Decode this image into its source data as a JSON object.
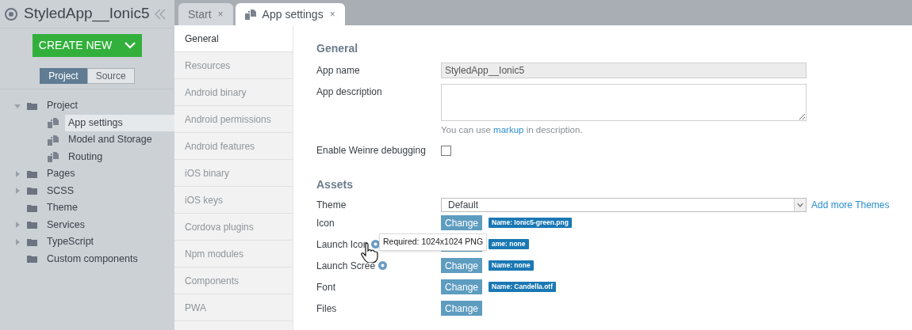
{
  "project": {
    "title": "StyledApp__Ionic5"
  },
  "create_button": {
    "label": "CREATE NEW"
  },
  "view_toggle": [
    {
      "label": "Project",
      "selected": true
    },
    {
      "label": "Source",
      "selected": false
    }
  ],
  "tree": [
    {
      "label": "Project",
      "kind": "group",
      "expanded": true,
      "selected": false,
      "children": [
        {
          "label": "App settings",
          "kind": "page",
          "selected": true
        },
        {
          "label": "Model and Storage",
          "kind": "page",
          "selected": false
        },
        {
          "label": "Routing",
          "kind": "page",
          "selected": false
        }
      ]
    },
    {
      "label": "Pages",
      "kind": "group",
      "expanded": false,
      "selected": false
    },
    {
      "label": "SCSS",
      "kind": "group",
      "expanded": false,
      "selected": false
    },
    {
      "label": "Theme",
      "kind": "folder",
      "selected": false
    },
    {
      "label": "Services",
      "kind": "group",
      "expanded": false,
      "selected": false
    },
    {
      "label": "TypeScript",
      "kind": "group",
      "expanded": false,
      "selected": false
    },
    {
      "label": "Custom components",
      "kind": "folder",
      "selected": false
    }
  ],
  "tabs": [
    {
      "label": "Start",
      "close": "×",
      "selected": false,
      "icon": false
    },
    {
      "label": "App settings",
      "close": "×",
      "selected": true,
      "icon": true
    }
  ],
  "settings_nav": [
    {
      "label": "General",
      "selected": true
    },
    {
      "label": "Resources",
      "selected": false
    },
    {
      "label": "Android binary",
      "selected": false
    },
    {
      "label": "Android permissions",
      "selected": false
    },
    {
      "label": "Android features",
      "selected": false
    },
    {
      "label": "iOS binary",
      "selected": false
    },
    {
      "label": "iOS keys",
      "selected": false
    },
    {
      "label": "Cordova plugins",
      "selected": false
    },
    {
      "label": "Npm modules",
      "selected": false
    },
    {
      "label": "Components",
      "selected": false
    },
    {
      "label": "PWA",
      "selected": false
    }
  ],
  "general": {
    "heading": "General",
    "app_name_label": "App name",
    "app_name": "StyledApp__Ionic5",
    "description_label": "App description",
    "hint_link": "markup",
    "hint_before": "You can use ",
    "hint_after": " in description.",
    "weinre_label": "Enable Weinre debugging",
    "weinre_checked": false
  },
  "assets": {
    "heading": "Assets",
    "theme_label": "Theme",
    "theme_value": "Default",
    "more_themes": "Add more Themes",
    "rows": [
      {
        "label": "Icon",
        "help": false,
        "button": "Change",
        "badge": "Name: Ionic5-green.png"
      },
      {
        "label": "Launch Icon",
        "help": true,
        "badge": "ame: none"
      },
      {
        "label": "Launch Scree",
        "help": true,
        "button": "Change",
        "badge": "Name: none"
      },
      {
        "label": "Font",
        "help": false,
        "button": "Change",
        "badge": "Name: Candella.otf"
      },
      {
        "label": "Files",
        "help": false,
        "button": "Change"
      }
    ]
  },
  "tooltip": {
    "text": "Required: 1024x1024 PNG"
  }
}
